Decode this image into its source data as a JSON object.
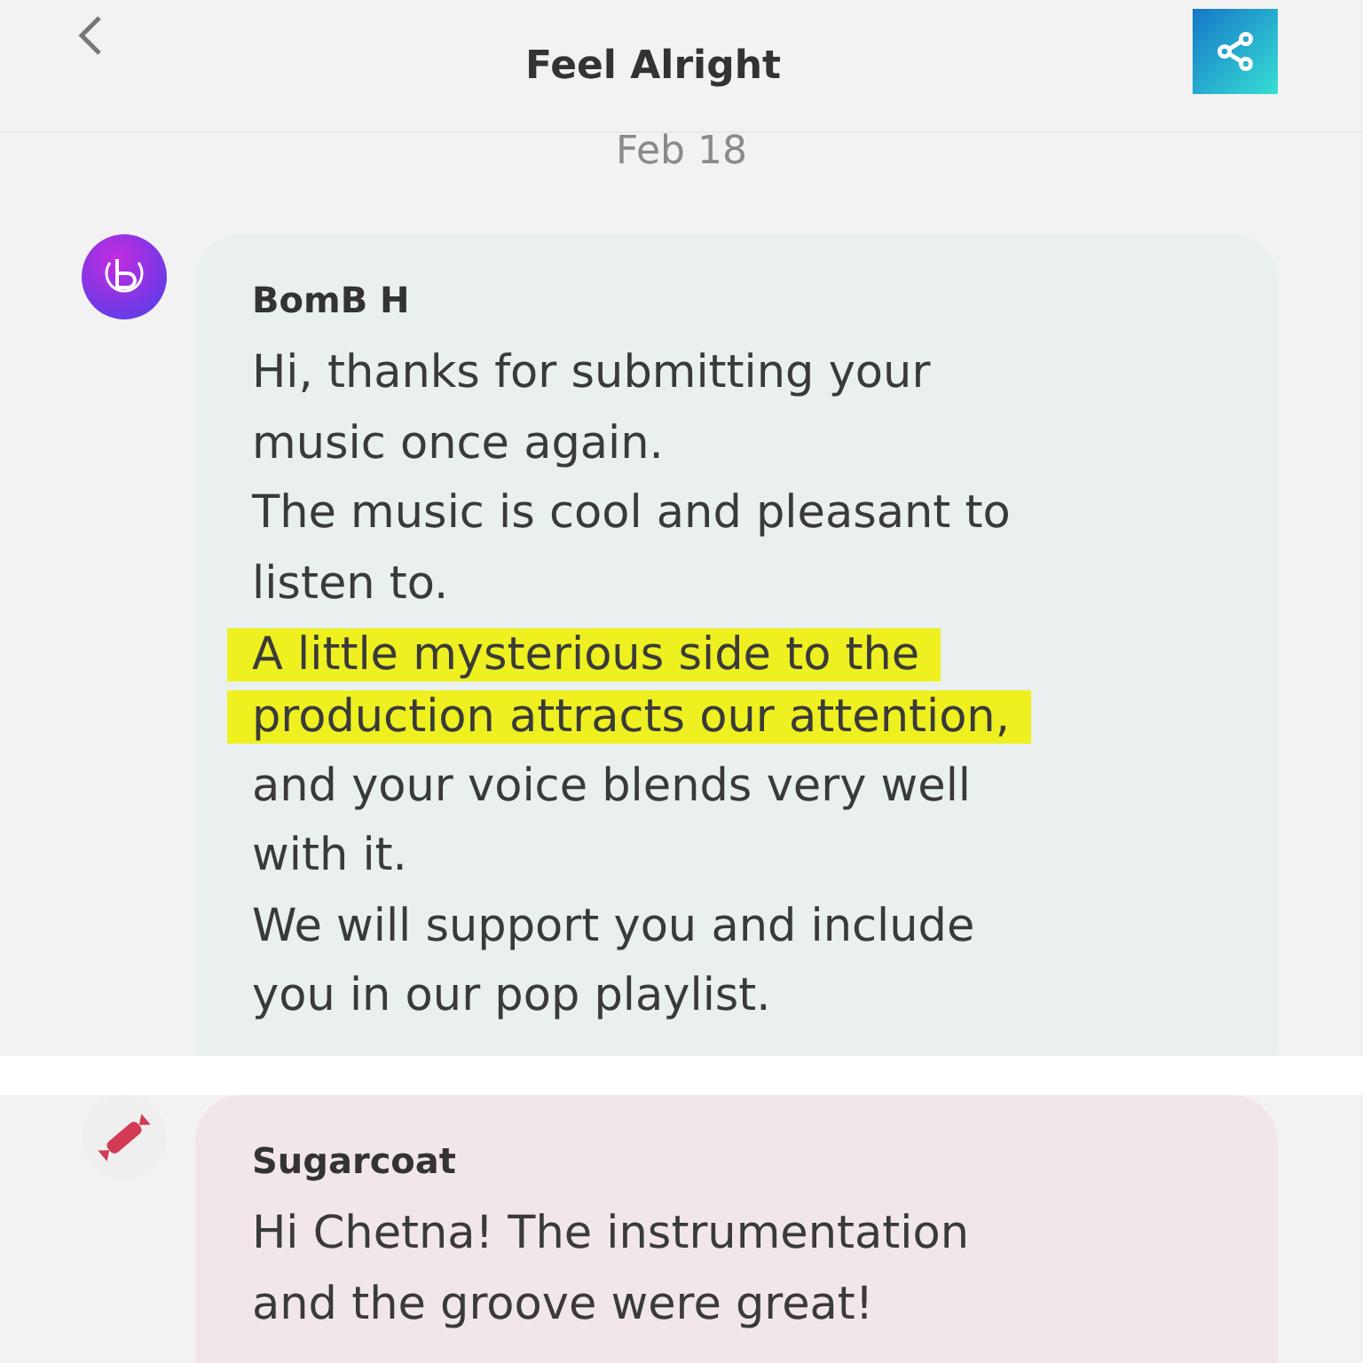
{
  "header": {
    "title": "Feel Alright"
  },
  "date": "Feb 18",
  "messages": [
    {
      "sender": "BomB H",
      "color": "#e9f0ef",
      "avatar": {
        "kind": "logo"
      },
      "lines": [
        {
          "text": "Hi, thanks for submitting your",
          "highlighted": false
        },
        {
          "text": "music once again.",
          "highlighted": false
        },
        {
          "text": "The music is cool and pleasant to",
          "highlighted": false
        },
        {
          "text": "listen to.",
          "highlighted": false
        },
        {
          "text": "A little mysterious side to the",
          "highlighted": true
        },
        {
          "text": "production attracts our attention,",
          "highlighted": true
        },
        {
          "text": "and your voice blends very well",
          "highlighted": false
        },
        {
          "text": "with it.",
          "highlighted": false
        },
        {
          "text": "We will support you and include",
          "highlighted": false
        },
        {
          "text": "you in our pop playlist.",
          "highlighted": false
        }
      ]
    },
    {
      "sender": "Sugarcoat",
      "color": "#f2e7e8",
      "avatar": {
        "kind": "candy"
      },
      "lines": [
        {
          "text": "Hi Chetna! The instrumentation",
          "highlighted": false
        },
        {
          "text": "and the groove were great!",
          "highlighted": false
        }
      ]
    }
  ]
}
